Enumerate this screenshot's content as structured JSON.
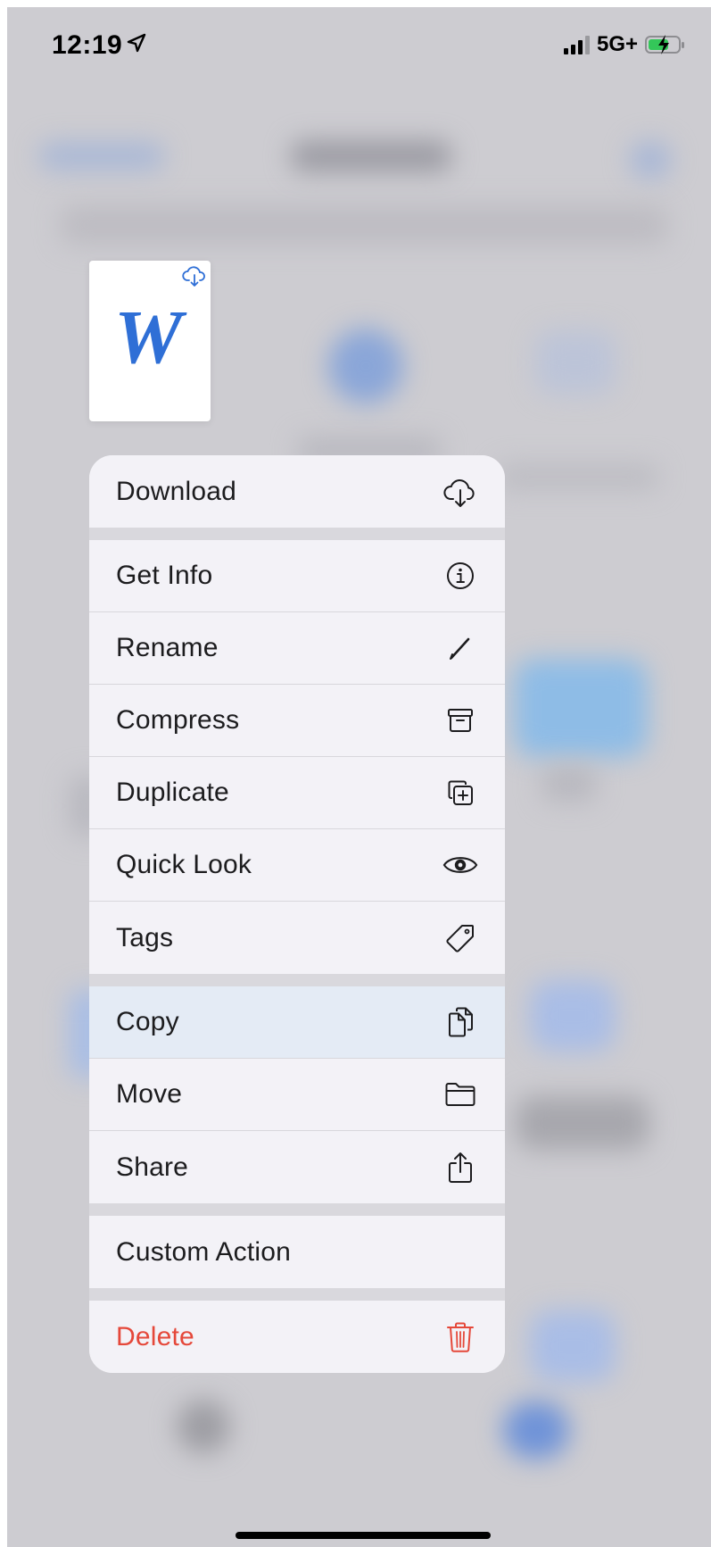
{
  "status_bar": {
    "time": "12:19",
    "location_glyph": "➤",
    "network": "5G+",
    "battery_state": "charging",
    "battery_color": "#34c759"
  },
  "document": {
    "icon_letter": "W",
    "accent_color": "#2f6fd6",
    "cloud_icon": "cloud-download-icon"
  },
  "menu": {
    "download": {
      "label": "Download",
      "icon": "cloud-download-icon"
    },
    "get_info": {
      "label": "Get Info",
      "icon": "info-icon"
    },
    "rename": {
      "label": "Rename",
      "icon": "pencil-icon"
    },
    "compress": {
      "label": "Compress",
      "icon": "archivebox-icon"
    },
    "duplicate": {
      "label": "Duplicate",
      "icon": "duplicate-icon"
    },
    "quick_look": {
      "label": "Quick Look",
      "icon": "eye-icon"
    },
    "tags": {
      "label": "Tags",
      "icon": "tag-icon"
    },
    "copy": {
      "label": "Copy",
      "icon": "copy-icon",
      "highlighted": true
    },
    "move": {
      "label": "Move",
      "icon": "folder-icon"
    },
    "share": {
      "label": "Share",
      "icon": "share-icon"
    },
    "custom_action": {
      "label": "Custom Action"
    },
    "delete": {
      "label": "Delete",
      "icon": "trash-icon",
      "color": "#e5483a"
    }
  }
}
